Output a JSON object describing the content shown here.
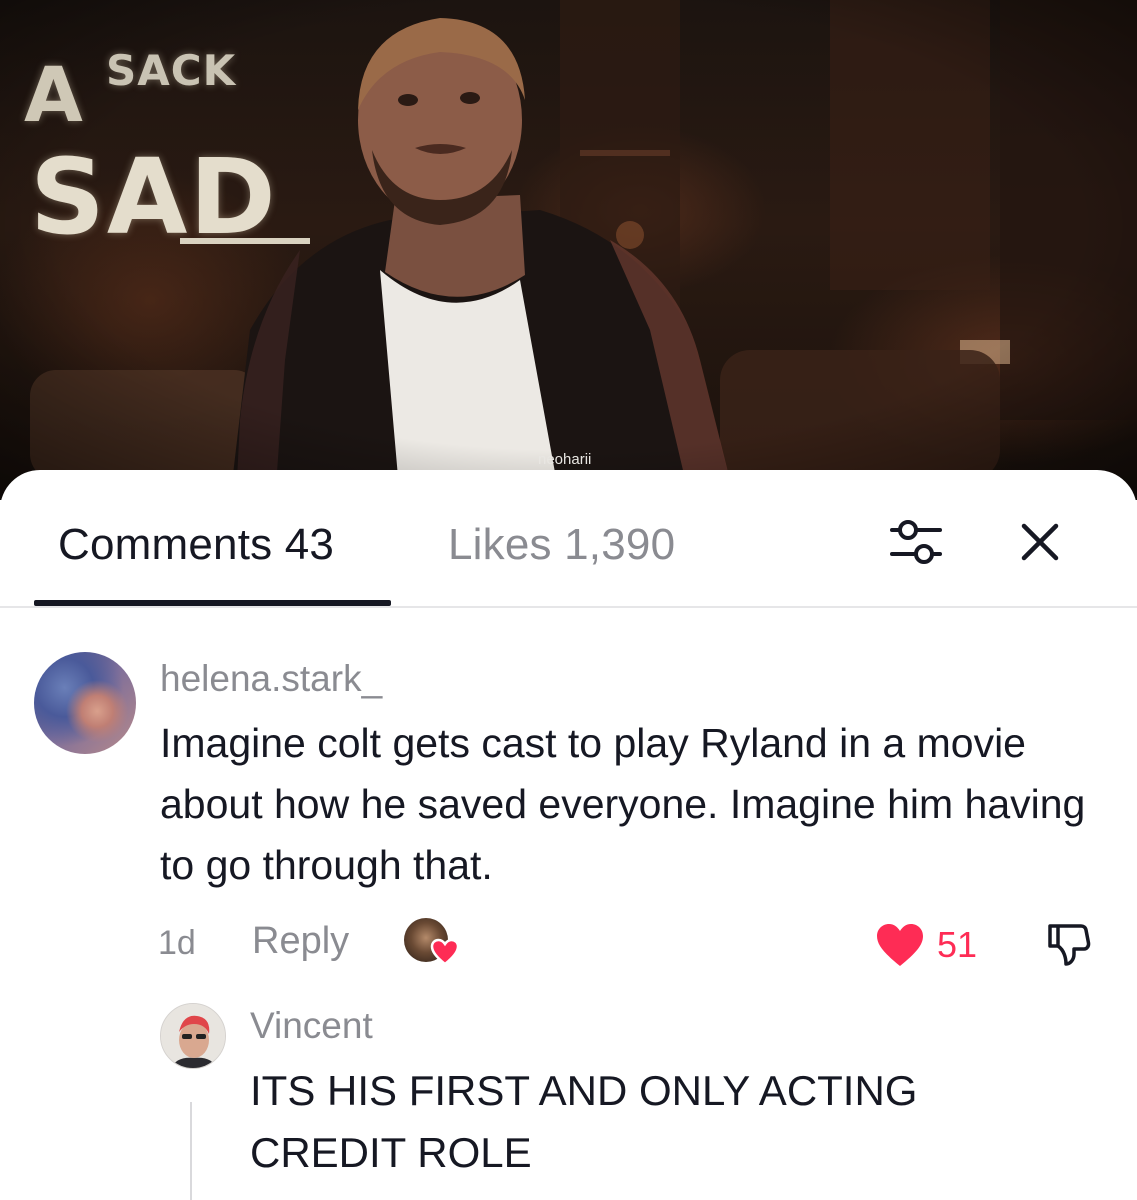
{
  "video": {
    "overlay_word_a": "A",
    "overlay_word_sack": "SACK",
    "overlay_word_sad": "SAD",
    "watermark": "neoharii"
  },
  "tabs": {
    "comments_label": "Comments 43",
    "likes_label": "Likes 1,390",
    "active": "comments"
  },
  "icons": {
    "filter": "filter-sliders-icon",
    "close": "close-icon",
    "like": "heart-icon",
    "dislike": "thumbs-down-icon"
  },
  "colors": {
    "accent_red": "#fe2c55",
    "text_primary": "#161823",
    "text_secondary": "#8a8b91"
  },
  "comment": {
    "username": "helena.stark_",
    "text": "Imagine colt gets cast to play Ryland in a movie about how he saved everyone. Imagine him having to go through that.",
    "time": "1d",
    "reply_label": "Reply",
    "like_count": "51"
  },
  "reply": {
    "username": "Vincent",
    "text": "ITS HIS FIRST AND ONLY ACTING CREDIT ROLE"
  }
}
